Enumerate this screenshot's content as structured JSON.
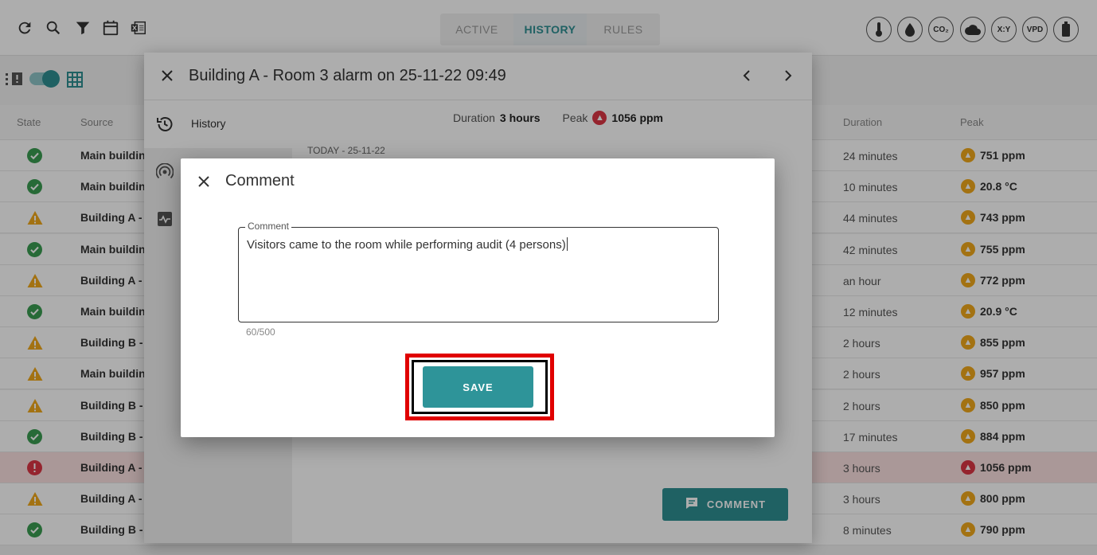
{
  "toolbar": {
    "icons": [
      "refresh-icon",
      "search-icon",
      "filter-icon",
      "calendar-icon",
      "export-excel-icon"
    ]
  },
  "tabs": [
    {
      "label": "ACTIVE",
      "active": false
    },
    {
      "label": "HISTORY",
      "active": true
    },
    {
      "label": "RULES",
      "active": false
    }
  ],
  "metrics": [
    {
      "name": "temperature-icon",
      "label": ""
    },
    {
      "name": "humidity-icon",
      "label": ""
    },
    {
      "name": "co2-icon",
      "label": "CO₂"
    },
    {
      "name": "cloud-icon",
      "label": ""
    },
    {
      "name": "xy-icon",
      "label": "X:Y"
    },
    {
      "name": "vpd-icon",
      "label": "VPD"
    },
    {
      "name": "battery-icon",
      "label": ""
    }
  ],
  "table": {
    "headers": {
      "state": "State",
      "source": "Source",
      "duration": "Duration",
      "peak": "Peak"
    },
    "rows": [
      {
        "state": "ok",
        "source": "Main building",
        "duration": "24 minutes",
        "peak": "751 ppm",
        "peak_level": "warn"
      },
      {
        "state": "ok",
        "source": "Main building",
        "duration": "10 minutes",
        "peak": "20.8 °C",
        "peak_level": "warn"
      },
      {
        "state": "warn",
        "source": "Building A - Room",
        "duration": "44 minutes",
        "peak": "743 ppm",
        "peak_level": "warn"
      },
      {
        "state": "ok",
        "source": "Main building",
        "duration": "42 minutes",
        "peak": "755 ppm",
        "peak_level": "warn"
      },
      {
        "state": "warn",
        "source": "Building A - Room",
        "duration": "an hour",
        "peak": "772 ppm",
        "peak_level": "warn"
      },
      {
        "state": "ok",
        "source": "Main building",
        "duration": "12 minutes",
        "peak": "20.9 °C",
        "peak_level": "warn"
      },
      {
        "state": "warn",
        "source": "Building B - Room",
        "duration": "2 hours",
        "peak": "855 ppm",
        "peak_level": "warn"
      },
      {
        "state": "warn",
        "source": "Main building",
        "duration": "2 hours",
        "peak": "957 ppm",
        "peak_level": "warn"
      },
      {
        "state": "warn",
        "source": "Building B - Room",
        "duration": "2 hours",
        "peak": "850 ppm",
        "peak_level": "warn"
      },
      {
        "state": "ok",
        "source": "Building B - Room",
        "duration": "17 minutes",
        "peak": "884 ppm",
        "peak_level": "warn"
      },
      {
        "state": "alert",
        "source": "Building A - Room",
        "duration": "3 hours",
        "peak": "1056 ppm",
        "peak_level": "alert"
      },
      {
        "state": "warn",
        "source": "Building A - Room",
        "duration": "3 hours",
        "peak": "800 ppm",
        "peak_level": "warn"
      },
      {
        "state": "ok",
        "source": "Building B - Room",
        "duration": "8 minutes",
        "peak": "790 ppm",
        "peak_level": "warn"
      }
    ]
  },
  "dialog": {
    "title": "Building A - Room 3 alarm on 25-11-22 09:49",
    "side_items": [
      {
        "icon": "history-icon",
        "label": "History"
      },
      {
        "icon": "sensor-icon",
        "label": ""
      },
      {
        "icon": "activity-icon",
        "label": ""
      }
    ],
    "summary": {
      "duration_label": "Duration",
      "duration_value": "3 hours",
      "peak_label": "Peak",
      "peak_value": "1056 ppm"
    },
    "today_label": "TODAY - 25-11-22",
    "comment_button": "COMMENT"
  },
  "modal": {
    "title": "Comment",
    "field_label": "Comment",
    "field_value": "Visitors came to the room while performing audit (4 persons)",
    "counter": "60/500",
    "save_label": "SAVE"
  },
  "colors": {
    "accent": "#2e8f93",
    "ok": "#3a9d52",
    "warn": "#f0a91b",
    "alert": "#dc3545",
    "highlight": "#e00000"
  }
}
